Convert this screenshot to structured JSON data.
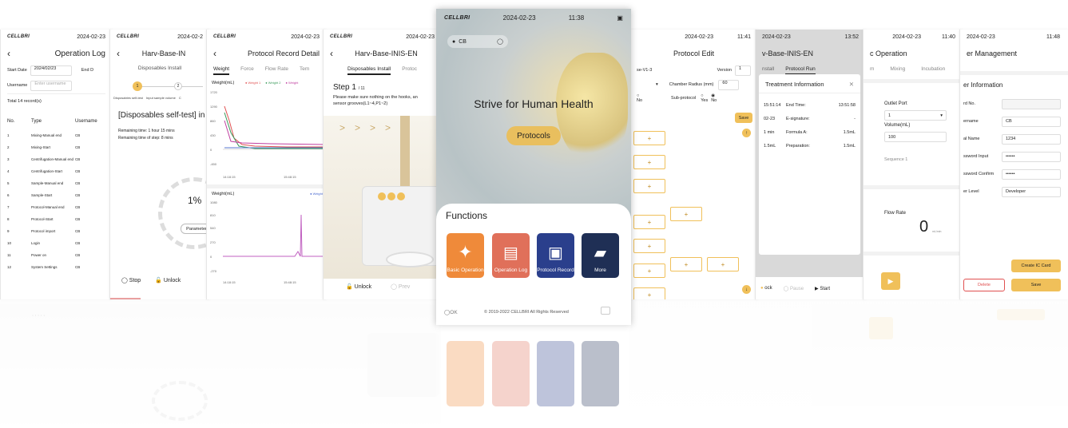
{
  "status": {
    "date": "2024-02-23",
    "brand": "CELLBRI"
  },
  "p1": {
    "date": "2024-02-23",
    "title": "Operation Log",
    "start_label": "Start Date",
    "start_value": "2024/02/23",
    "end_label": "End D",
    "username_label": "Username",
    "username_placeholder": "Enter username",
    "total": "Total 14 record(s)",
    "headers": [
      "No.",
      "Type",
      "Username"
    ],
    "rows": [
      [
        "1",
        "Mixing-Manual end",
        "CB"
      ],
      [
        "2",
        "Mixing-Start",
        "CB"
      ],
      [
        "3",
        "Centrifugation-Manual end",
        "CB"
      ],
      [
        "4",
        "Centrifugation-Start",
        "CB"
      ],
      [
        "5",
        "Sample-Manual end",
        "CB"
      ],
      [
        "6",
        "Sample-Start",
        "CB"
      ],
      [
        "7",
        "Protocol-Manual end",
        "CB"
      ],
      [
        "8",
        "Protocol-Start",
        "CB"
      ],
      [
        "9",
        "Protocol import",
        "CB"
      ],
      [
        "10",
        "Login",
        "CB"
      ],
      [
        "11",
        "Power on",
        "CB"
      ],
      [
        "12",
        "System Settings",
        "CB"
      ]
    ]
  },
  "p2": {
    "date": "2024-02-2",
    "title": "Harv-Base-IN",
    "subtitle": "Disposables Install",
    "step1": "1",
    "step2": "2",
    "lbl_a": "Disposables self-test",
    "lbl_b": "Input sample volume",
    "lbl_c": "C",
    "heading": "[Disposables self-test] in p",
    "remain1": "Remaining time: 1 hour 15 mins",
    "remain2": "Remaining time of step: 8 mins",
    "percent": "1%",
    "param": "Parameter",
    "stop": "Stop",
    "unlock": "Unlock"
  },
  "p3": {
    "date": "2024-02-23",
    "title": "Protocol Record Detail",
    "tabs": [
      "Weight",
      "Force",
      "Flow Rate",
      "Tem"
    ],
    "chart1_label": "Weight(mL)",
    "legend": [
      "Weight 1",
      "Weight 2",
      "Weight"
    ],
    "y1": [
      "1720",
      "1290",
      "860",
      "430",
      "0",
      "-450"
    ],
    "x1": [
      "14:18:15",
      "15:48:15"
    ],
    "chart2_label": "Weight(mL)",
    "legend2": "Weight",
    "y2": [
      "1080",
      "810",
      "540",
      "270",
      "0",
      "-270"
    ],
    "x2": [
      "14:18:15",
      "15:48:15"
    ]
  },
  "p4": {
    "date": "2024-02-23",
    "title": "Harv-Base-INIS-EN",
    "tabs": [
      "Disposables Install",
      "Protoc"
    ],
    "step": "Step 1",
    "step_of": "/ 11",
    "instr": "Please make sure nothing on the hooks, an",
    "instr2": "sensor grooves(L1~4,P1~2)",
    "unlock": "Unlock",
    "prev": "Prev"
  },
  "p5": {
    "date": "2024-02-23",
    "time": "11:38",
    "user": "CB",
    "hero": "Strive for Human Health",
    "protocols": "Protocols",
    "functions": "Functions",
    "items": [
      "Basic Operation",
      "Operation Log",
      "Protocol Record",
      "More"
    ],
    "ok": "OK",
    "copyright": "© 2019-2022 CELLBRI All Rights Reserved"
  },
  "p6": {
    "date": "2024-02-23",
    "time": "11:41",
    "title": "Protocol Edit",
    "name": "se-V1-3",
    "version_label": "Version",
    "version": "1",
    "chamber_label": "Chamber Radius (mm)",
    "chamber": "60",
    "no": "No",
    "sub_label": "Sub-protocol",
    "yes": "Yes",
    "no2": "No",
    "save": "Save",
    "plus": "+"
  },
  "p7": {
    "date": "2024-02-23",
    "time": "13:52",
    "title": "v-Base-INIS-EN",
    "tabs": [
      "nstall",
      "Protocol Run"
    ],
    "modal_title": "Treatment Information",
    "rows": [
      [
        "15:51:14",
        "End Time:",
        "13:51:58"
      ],
      [
        "02-23",
        "E-signature:",
        "-"
      ],
      [
        "1 min",
        "Formula A:",
        "1.5mL"
      ],
      [
        "1.5mL",
        "Preparation:",
        "1.5mL"
      ]
    ],
    "lock": "ock",
    "pause": "Pause",
    "start": "Start"
  },
  "p8": {
    "date": "2024-02-23",
    "time": "11:40",
    "title": "c Operation",
    "tabs": [
      "m",
      "Mixing",
      "Incubation"
    ],
    "outlet_label": "Outlet Port",
    "outlet": "1",
    "volume_label": "Volume(mL)",
    "volume": "100",
    "sequence": "Sequence  1",
    "flow_label": "Flow Rate",
    "flow": "0",
    "flow_unit": "mL/min"
  },
  "p9": {
    "date": "2024-02-23",
    "time": "11:48",
    "title": "er Management",
    "section": "er Information",
    "labels": [
      "rd No.",
      "ername",
      "al Name",
      "ssword Input",
      "ssword Confirm",
      "er Level"
    ],
    "values": [
      "",
      "CB",
      "1234",
      "••••••",
      "••••••",
      "Developer"
    ],
    "create": "Create IC Card",
    "delete": "Delete",
    "save": "Save"
  },
  "colors": {
    "gold": "#f0c05a",
    "orange": "#ef8a3a",
    "coral": "#e0705a",
    "navy": "#2a3f8c",
    "dark": "#1f2f55"
  }
}
